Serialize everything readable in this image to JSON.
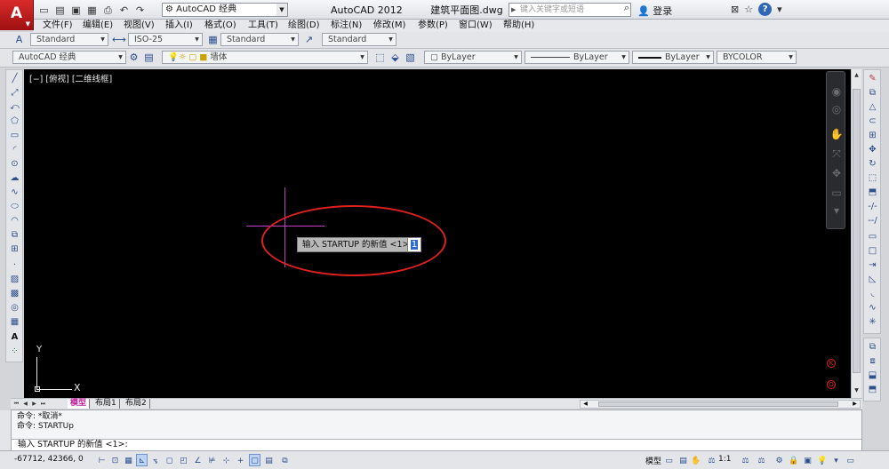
{
  "window": {
    "app_logo": "A",
    "workspace": "AutoCAD 经典",
    "app_name": "AutoCAD 2012",
    "file_name": "建筑平面图.dwg",
    "search_placeholder": "键入关键字或短语",
    "login": "登录"
  },
  "menu": [
    "文件(F)",
    "编辑(E)",
    "视图(V)",
    "插入(I)",
    "格式(O)",
    "工具(T)",
    "绘图(D)",
    "标注(N)",
    "修改(M)",
    "参数(P)",
    "窗口(W)",
    "帮助(H)"
  ],
  "toolbar": {
    "text_style": "Standard",
    "dim_style": "ISO-25",
    "table_style": "Standard",
    "multileader_style": "Standard",
    "workspace2": "AutoCAD 经典",
    "layer": "墙体",
    "color": "ByLayer",
    "linetype": "ByLayer",
    "lineweight": "ByLayer",
    "plotstyle": "BYCOLOR"
  },
  "viewport": {
    "label": "[−] [俯视] [二维线框]",
    "prompt": "输入 STARTUP 的新值 <1>:",
    "input_value": "1",
    "ucs_x": "X",
    "ucs_y": "Y"
  },
  "layout_tabs": [
    "模型",
    "布局1",
    "布局2"
  ],
  "command": {
    "history": [
      "命令: *取消*",
      "命令: STARTUp"
    ],
    "current": "输入 STARTUP 的新值 <1>:"
  },
  "status": {
    "coords": "-67712, 42366, 0",
    "model": "模型",
    "scale": "1:1"
  },
  "colors": {
    "accent_red": "#e02020",
    "crosshair": "#c23fc2",
    "canvas": "#000000"
  }
}
